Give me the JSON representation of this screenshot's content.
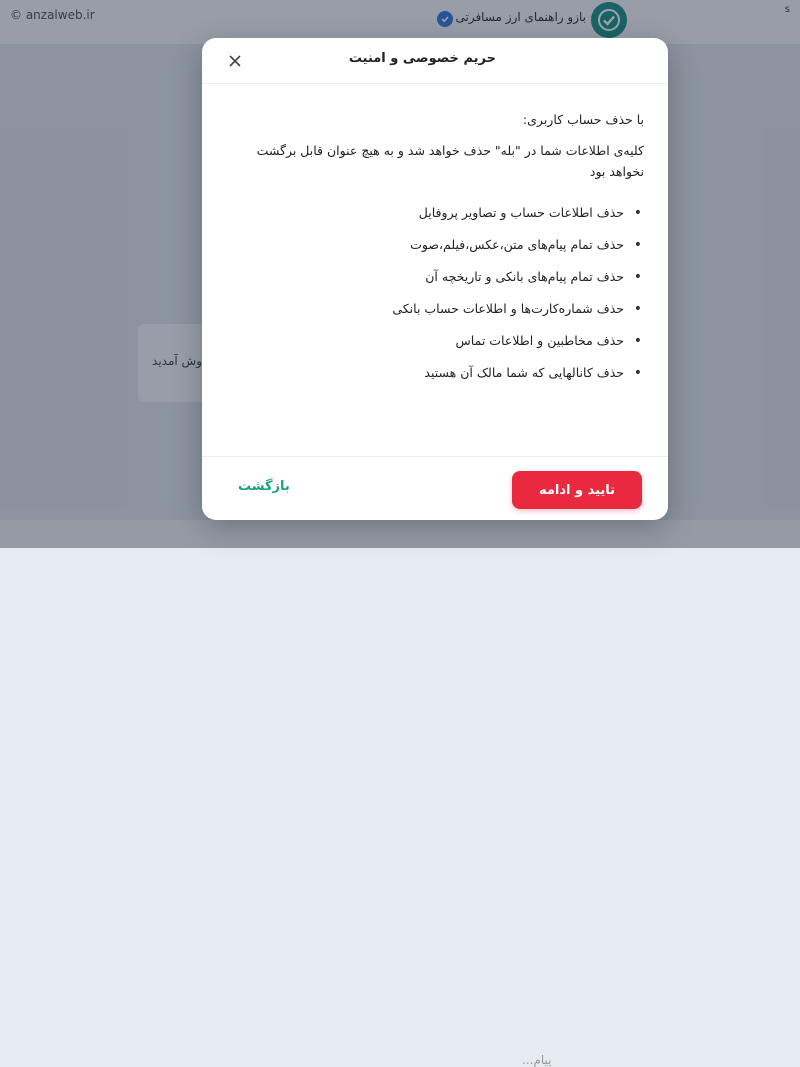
{
  "watermark": "© anzalweb.ir",
  "header": {
    "channel_name": "بازو راهنمای ارز مسافرتی",
    "corner_letter": "s"
  },
  "background": {
    "bubble_text": "وش آمدید",
    "message_placeholder": "پیام..."
  },
  "modal": {
    "title": "حریم خصوصی و امنیت",
    "intro": "با حذف حساب کاربری:",
    "description": "کلیه‌ی اطلاعات شما در \"بله\" حذف خواهد شد و به هیچ عنوان قابل برگشت نخواهد بود",
    "items": [
      "حذف اطلاعات حساب و تصاویر پروفایل",
      "حذف تمام پیام‌های متن،عکس،فیلم،صوت",
      "حذف تمام پیام‌های بانکی و تاریخچه آن",
      "حذف شماره‌کارت‌ها و اطلاعات حساب بانکی",
      "حذف مخاطبین و اطلاعات تماس",
      "حذف کانالهایی که شما مالک آن هستید"
    ],
    "confirm_label": "تایید و ادامه",
    "back_label": "بازگشت"
  },
  "colors": {
    "accent_red": "#e8293f",
    "accent_green": "#1aa37a",
    "avatar_teal": "#0e8a80",
    "verified_blue": "#2a6fd6"
  },
  "icons": [
    "close-icon",
    "check-icon",
    "verified-icon"
  ]
}
